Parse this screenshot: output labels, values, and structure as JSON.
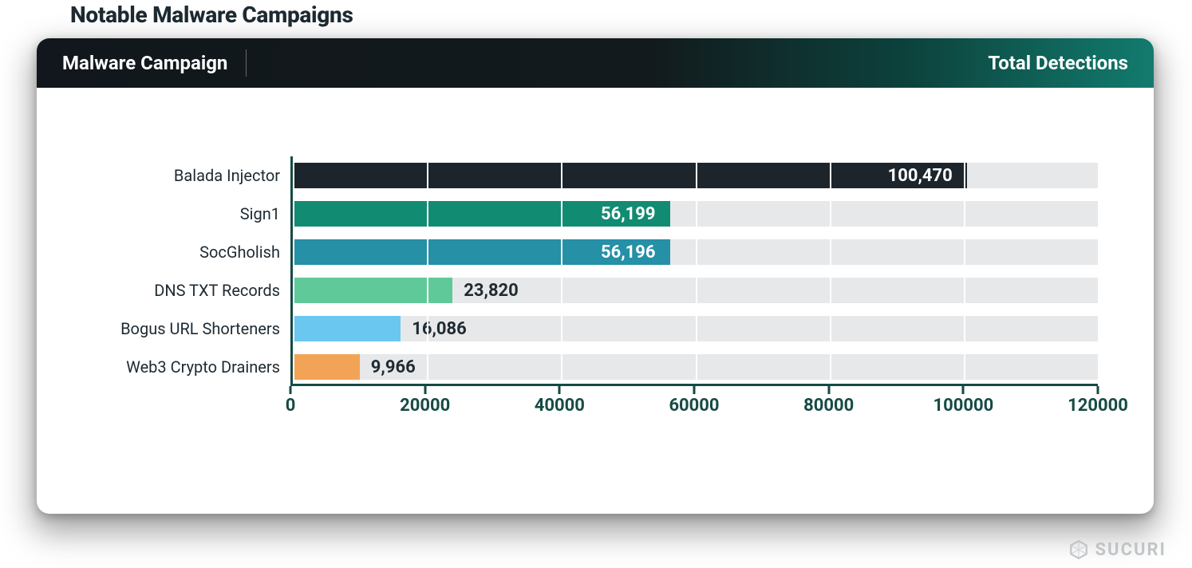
{
  "title": "Notable Malware Campaigns",
  "header": {
    "left": "Malware Campaign",
    "right": "Total Detections"
  },
  "watermark": "SUCURI",
  "chart_data": {
    "type": "bar",
    "orientation": "horizontal",
    "title": "Notable Malware Campaigns",
    "xlabel": "",
    "ylabel": "",
    "xlim": [
      0,
      120000
    ],
    "x_ticks": [
      0,
      20000,
      40000,
      60000,
      80000,
      100000,
      120000
    ],
    "categories": [
      "Balada Injector",
      "Sign1",
      "SocGholish",
      "DNS TXT Records",
      "Bogus URL Shorteners",
      "Web3 Crypto Drainers"
    ],
    "values": [
      100470,
      56199,
      56196,
      23820,
      16086,
      9966
    ],
    "value_labels": [
      "100,470",
      "56,199",
      "56,196",
      "23,820",
      "16,086",
      "9,966"
    ],
    "colors": [
      "#1d252c",
      "#128b73",
      "#2590a6",
      "#5fc999",
      "#6ac7f0",
      "#f3a356"
    ],
    "label_inside": [
      true,
      true,
      true,
      false,
      false,
      false
    ]
  }
}
